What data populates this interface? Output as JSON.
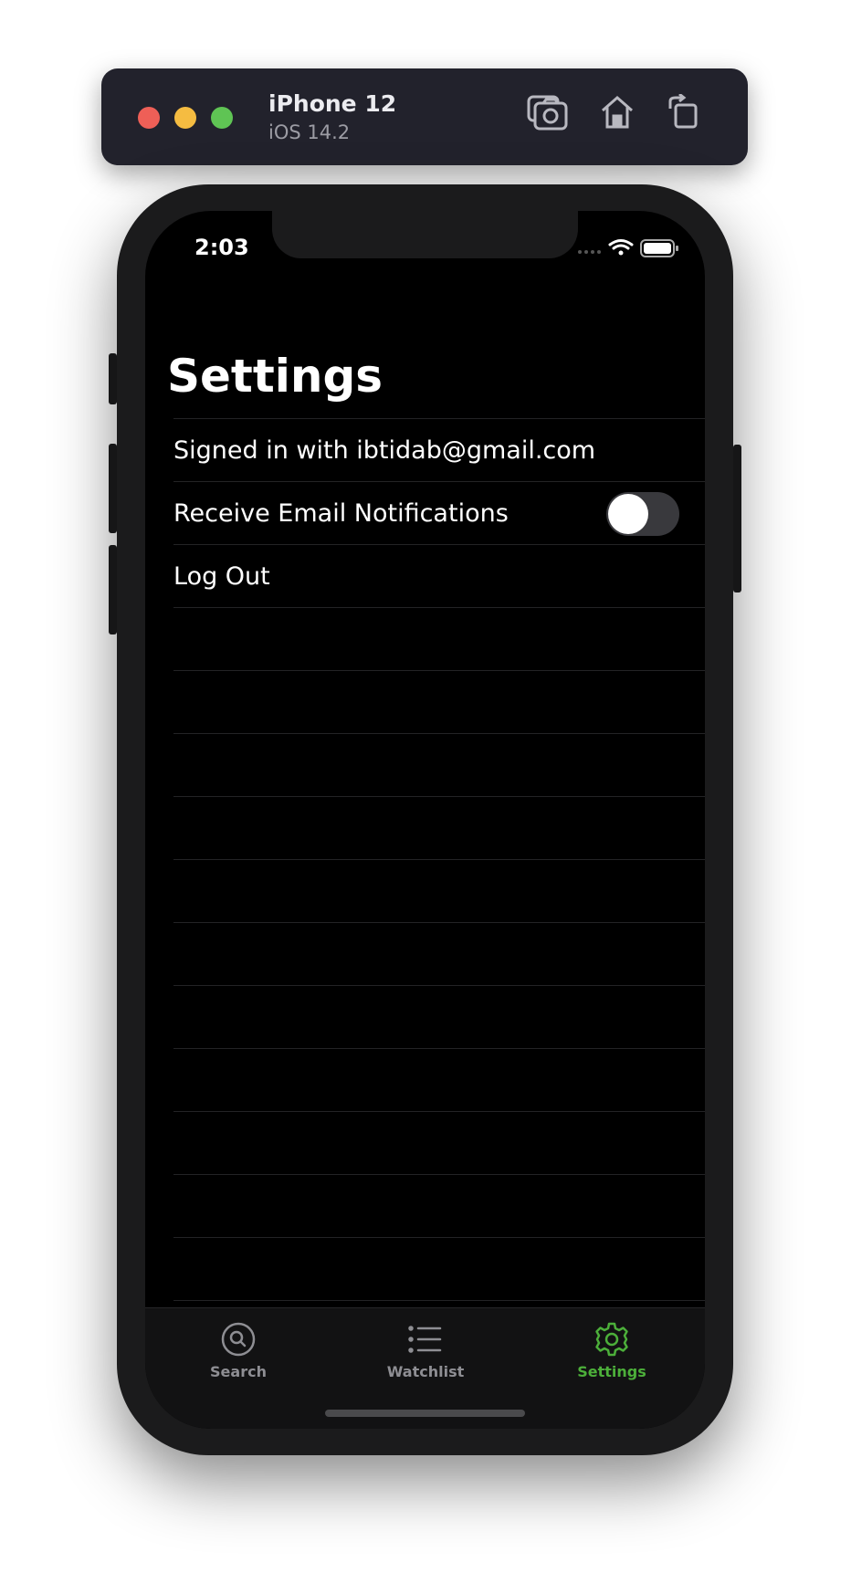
{
  "simulator": {
    "device_name": "iPhone 12",
    "os_version": "iOS 14.2",
    "toolbar_icons": [
      "screenshot-icon",
      "home-icon",
      "rotate-icon"
    ]
  },
  "status_bar": {
    "time": "2:03",
    "icons": [
      "signal-icon",
      "wifi-icon",
      "battery-icon"
    ]
  },
  "page": {
    "title": "Settings"
  },
  "settings_rows": {
    "signed_in": "Signed in with ibtidab@gmail.com",
    "email_notifications": {
      "label": "Receive Email Notifications",
      "enabled": false
    },
    "log_out": "Log Out"
  },
  "tabbar": {
    "active": "Settings",
    "tabs": [
      {
        "label": "Search",
        "icon": "search-icon"
      },
      {
        "label": "Watchlist",
        "icon": "list-icon"
      },
      {
        "label": "Settings",
        "icon": "gear-icon"
      }
    ]
  },
  "colors": {
    "accent": "#4caf3a",
    "inactive_tab": "#8e8e93",
    "background": "#000000"
  }
}
